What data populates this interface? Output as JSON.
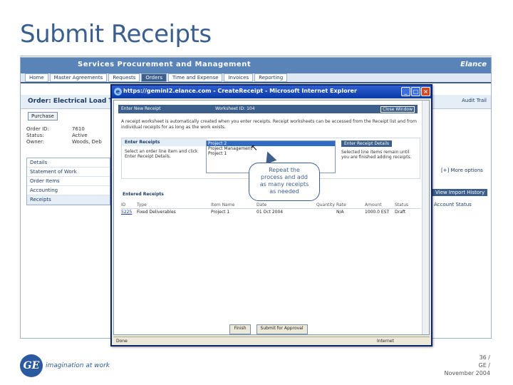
{
  "slide": {
    "title": "Submit Receipts",
    "tagline": "imagination at work",
    "logo_text": "GE",
    "page_number": "36 /",
    "org": "GE /",
    "date": "November 2004"
  },
  "app": {
    "header_title": "Services Procurement and Management",
    "brand": "Elance",
    "nav": [
      "Home",
      "Master Agreements",
      "Requests",
      "Orders",
      "Time and Expense",
      "Invoices",
      "Reporting"
    ],
    "active_nav": "Orders",
    "order_label": "Order: Electrical Load Test",
    "right_links": "Audit Trail",
    "purchase_button": "Purchase",
    "meta": [
      {
        "label": "Order ID:",
        "value": "7610"
      },
      {
        "label": "Status:",
        "value": "Active"
      },
      {
        "label": "Owner:",
        "value": "Woods, Deb"
      }
    ],
    "left_nav": [
      "Details",
      "Statement of Work",
      "Order Items",
      "Accounting",
      "Receipts"
    ],
    "more_options": "[+] More options",
    "view_history": "View Import History",
    "account_status": "Account Status"
  },
  "popup": {
    "title": "https://geminI2.elance.com - CreateReceipt - Microsoft Internet Explorer",
    "header_left": "Enter New Receipt",
    "header_mid": "Worksheet ID: 104",
    "close_window": "Close Window",
    "intro": "A receipt worksheet is automatically created when you enter receipts. Receipt worksheets can be accessed from the Receipt list and from individual receipts for as long as the work exists.",
    "enter_receipts": "Enter Receipts",
    "enter_text": "Select an order line item and click Enter Receipt Details.",
    "list_items": [
      "Project 2",
      "Project Management",
      "Project 1"
    ],
    "enter_details_button": "Enter Receipt Details",
    "right_text": "Selected line items remain until you are finished adding receipts.",
    "entered_receipts": "Entered Receipts",
    "columns": [
      "ID",
      "Type",
      "Item Name",
      "Date",
      "Quantity",
      "Rate",
      "Amount",
      "Status"
    ],
    "rows": [
      {
        "id": "5225",
        "type": "Fixed Deliverables",
        "item": "Project 1",
        "date": "01 Oct 2004",
        "qty": "",
        "rate": "N/A",
        "amount": "1000.0 EST",
        "status": "Draft"
      }
    ],
    "finish_button": "Finish",
    "submit_button": "Submit for Approval",
    "status_done": "Done",
    "status_zone": "Internet"
  },
  "callout": {
    "line1": "Repeat the",
    "line2": "process and add",
    "line3": "as many receipts",
    "line4": "as needed"
  }
}
